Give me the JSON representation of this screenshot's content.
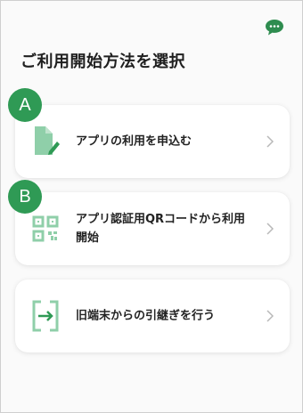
{
  "page": {
    "title": "ご利用開始方法を選択"
  },
  "options": [
    {
      "label": "アプリの利用を申込む",
      "icon": "document-edit-icon"
    },
    {
      "label": "アプリ認証用QRコードから利用開始",
      "icon": "qr-code-icon"
    },
    {
      "label": "旧端末からの引継ぎを行う",
      "icon": "device-transfer-icon"
    }
  ],
  "badges": [
    "A",
    "B"
  ],
  "colors": {
    "accent": "#2f9a55",
    "icon": "#8fcfa9",
    "chevron": "#b8b8b8",
    "chat": "#2e8c4f"
  }
}
